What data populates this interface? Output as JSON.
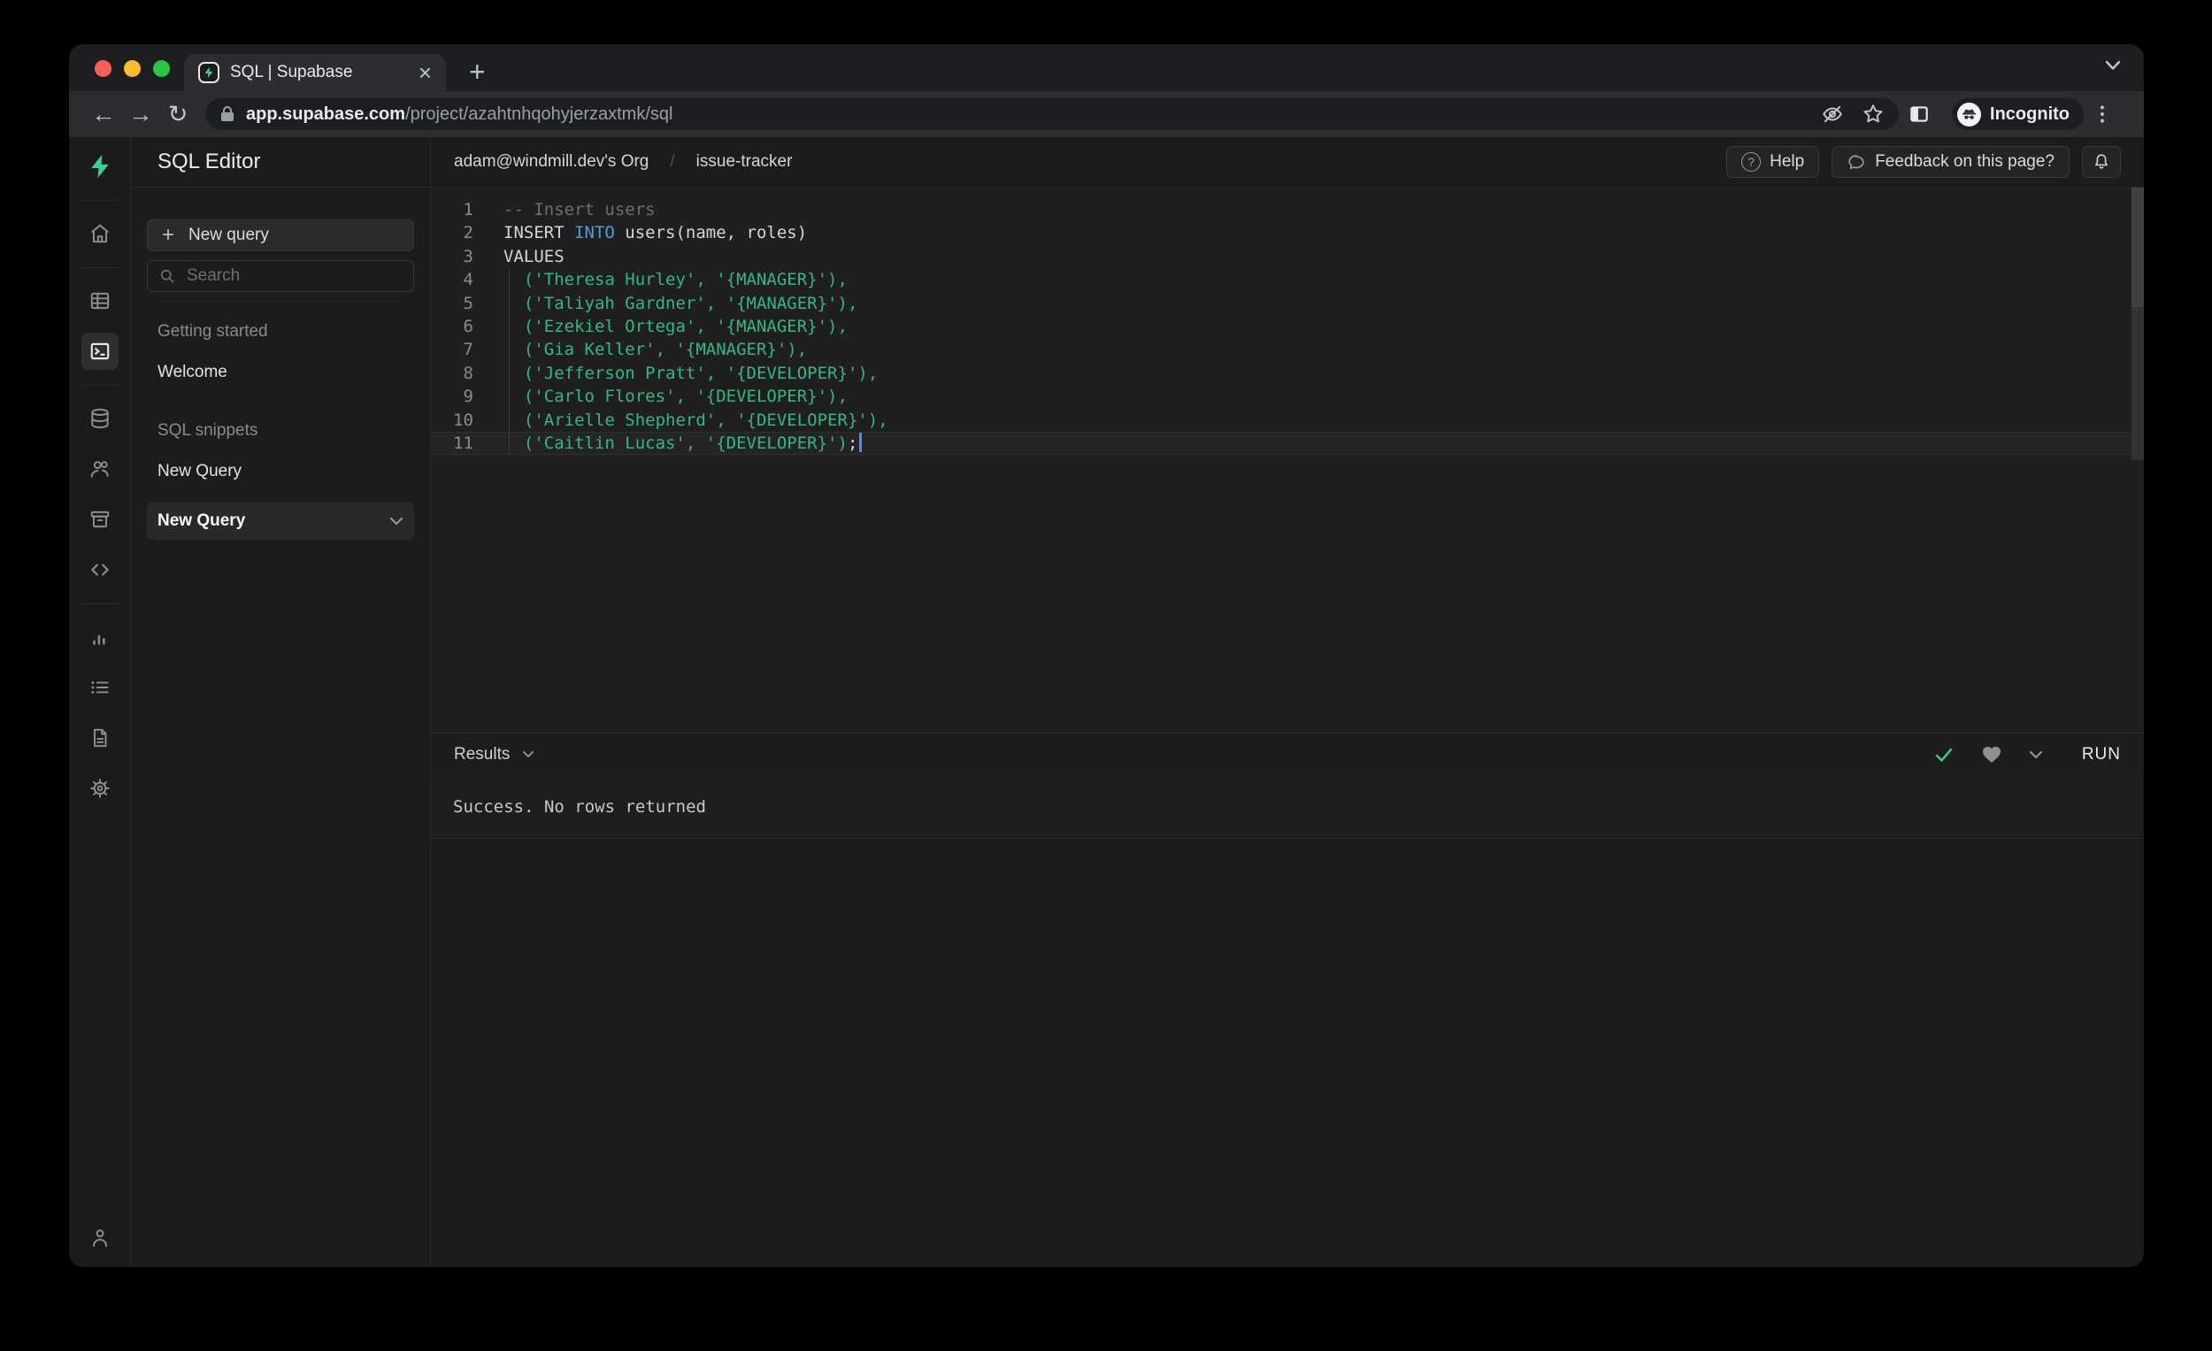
{
  "browser": {
    "tab_title": "SQL | Supabase",
    "url_domain": "app.supabase.com",
    "url_path": "/project/azahtnhqohyjerzaxtmk/sql",
    "incognito_label": "Incognito"
  },
  "rail_icons": [
    "supabase-logo",
    "home",
    "table-editor",
    "sql-editor",
    "database",
    "authentication",
    "storage",
    "api",
    "reports",
    "logs",
    "docs",
    "settings",
    "account"
  ],
  "panel": {
    "title": "SQL Editor",
    "new_query_button": "New query",
    "search_placeholder": "Search",
    "section1_label": "Getting started",
    "welcome_item": "Welcome",
    "section2_label": "SQL snippets",
    "snippet1": "New Query",
    "snippet2": "New Query"
  },
  "header": {
    "breadcrumb_org": "adam@windmill.dev's Org",
    "breadcrumb_sep": "/",
    "breadcrumb_project": "issue-tracker",
    "help": "Help",
    "feedback": "Feedback on this page?"
  },
  "editor": {
    "lines": [
      {
        "num": 1,
        "tokens": [
          [
            "comment",
            "-- Insert users"
          ]
        ]
      },
      {
        "num": 2,
        "tokens": [
          [
            "plain",
            "INSERT "
          ],
          [
            "keyword",
            "INTO"
          ],
          [
            "plain",
            " users(name, roles)"
          ]
        ]
      },
      {
        "num": 3,
        "tokens": [
          [
            "plain",
            "VALUES"
          ]
        ]
      },
      {
        "num": 4,
        "guide": true,
        "tokens": [
          [
            "plain",
            "  "
          ],
          [
            "string",
            "('Theresa Hurley', '{MANAGER}'),"
          ]
        ]
      },
      {
        "num": 5,
        "guide": true,
        "tokens": [
          [
            "plain",
            "  "
          ],
          [
            "string",
            "('Taliyah Gardner', '{MANAGER}'),"
          ]
        ]
      },
      {
        "num": 6,
        "guide": true,
        "tokens": [
          [
            "plain",
            "  "
          ],
          [
            "string",
            "('Ezekiel Ortega', '{MANAGER}'),"
          ]
        ]
      },
      {
        "num": 7,
        "guide": true,
        "tokens": [
          [
            "plain",
            "  "
          ],
          [
            "string",
            "('Gia Keller', '{MANAGER}'),"
          ]
        ]
      },
      {
        "num": 8,
        "guide": true,
        "tokens": [
          [
            "plain",
            "  "
          ],
          [
            "string",
            "('Jefferson Pratt', '{DEVELOPER}'),"
          ]
        ]
      },
      {
        "num": 9,
        "guide": true,
        "tokens": [
          [
            "plain",
            "  "
          ],
          [
            "string",
            "('Carlo Flores', '{DEVELOPER}'),"
          ]
        ]
      },
      {
        "num": 10,
        "guide": true,
        "tokens": [
          [
            "plain",
            "  "
          ],
          [
            "string",
            "('Arielle Shepherd', '{DEVELOPER}'),"
          ]
        ]
      },
      {
        "num": 11,
        "guide": true,
        "active": true,
        "cursor": true,
        "tokens": [
          [
            "plain",
            "  "
          ],
          [
            "string",
            "('Caitlin Lucas', '{DEVELOPER}')"
          ],
          [
            "plain",
            ";"
          ]
        ]
      }
    ]
  },
  "results": {
    "label": "Results",
    "run": "RUN",
    "message": "Success. No rows returned"
  },
  "colors": {
    "accent_green": "#3ecf8e",
    "keyword_blue": "#569cd6",
    "string_green": "#30b980",
    "comment_gray": "#6d6d6d",
    "cursor_blue": "#4e8ef7"
  }
}
